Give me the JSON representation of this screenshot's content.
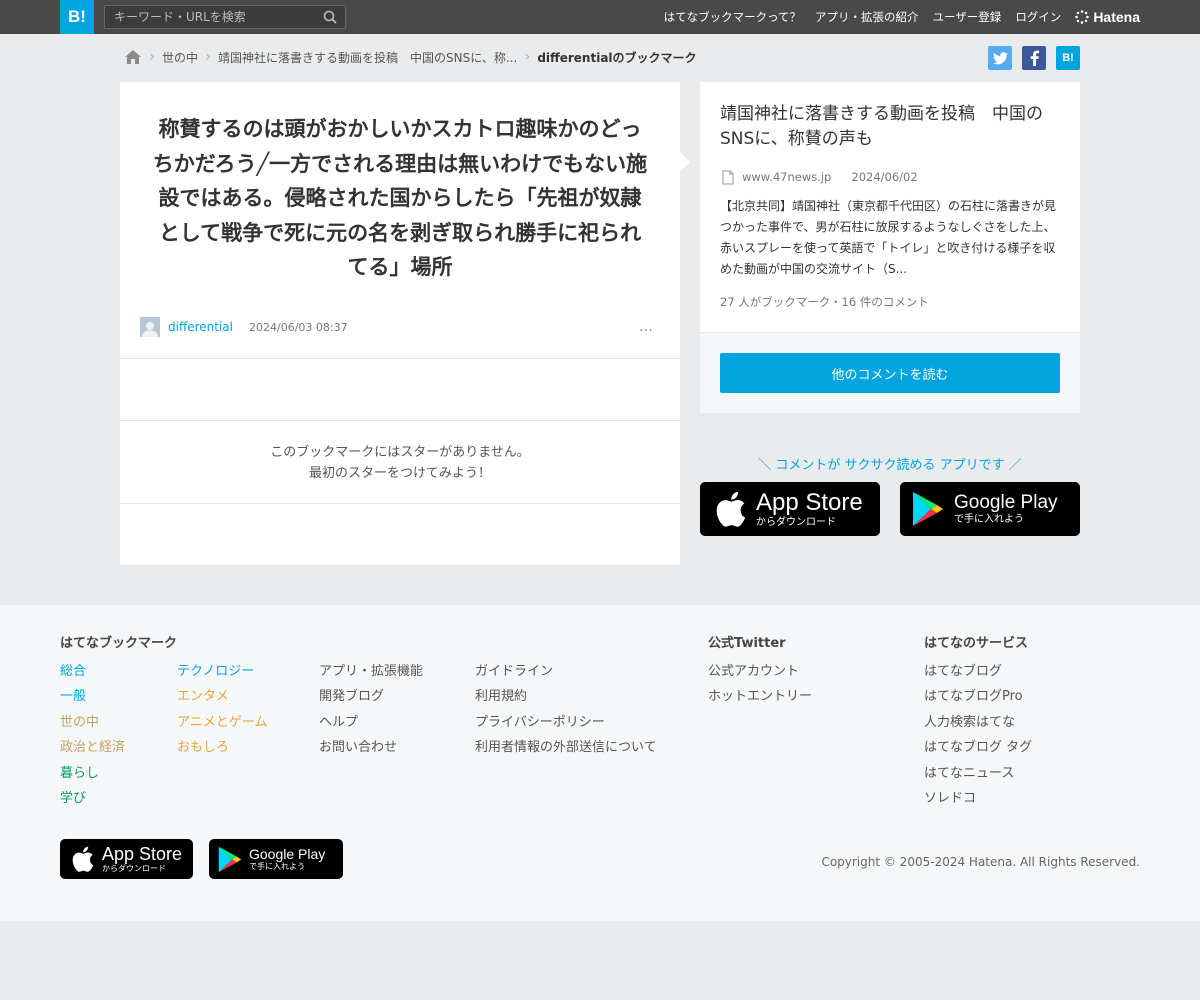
{
  "header": {
    "logo": "B!",
    "search_placeholder": "キーワード・URLを検索",
    "nav": [
      "はてなブックマークって？",
      "アプリ・拡張の紹介",
      "ユーザー登録",
      "ログイン"
    ],
    "brand": "Hatena"
  },
  "breadcrumb": {
    "items": [
      "世の中",
      "靖国神社に落書きする動画を投稿　中国のSNSに、称..."
    ],
    "current": "differentialのブックマーク"
  },
  "share": {
    "hatena": "B!"
  },
  "comment": {
    "text": "称賛するのは頭がおかしいかスカトロ趣味かのどっちかだろう╱一方でされる理由は無いわけでもない施設ではある。侵略された国からしたら「先祖が奴隷として戦争で死に元の名を剥ぎ取られ勝手に祀られてる」場所",
    "user": "differential",
    "datetime": "2024/06/03 08:37",
    "more": "…",
    "stars_line1": "このブックマークにはスターがありません。",
    "stars_line2": "最初のスターをつけてみよう！"
  },
  "entry": {
    "title": "靖国神社に落書きする動画を投稿　中国のSNSに、称賛の声も",
    "domain": "www.47news.jp",
    "date": "2024/06/02",
    "summary": "【北京共同】靖国神社（東京都千代田区）の石柱に落書きが見つかった事件で、男が石柱に放尿するようなしぐさをした上、赤いスプレーを使って英語で「トイレ」と吹き付ける様子を収めた動画が中国の交流サイト（S...",
    "counts": "27 人がブックマーク・16 件のコメント",
    "read_button": "他のコメントを読む"
  },
  "promo": {
    "text": "＼ コメントが サクサク読める アプリです ／",
    "appstore_big": "App Store",
    "appstore_small": "からダウンロード",
    "googleplay_big": "Google Play",
    "googleplay_small": "で手に入れよう"
  },
  "footer": {
    "bookmark_title": "はてなブックマーク",
    "categories_col1": [
      "総合",
      "一般",
      "世の中",
      "政治と経済",
      "暮らし",
      "学び"
    ],
    "categories_col2": [
      "テクノロジー",
      "エンタメ",
      "アニメとゲーム",
      "おもしろ"
    ],
    "links_col3": [
      "アプリ・拡張機能",
      "開発ブログ",
      "ヘルプ",
      "お問い合わせ"
    ],
    "links_col4": [
      "ガイドライン",
      "利用規約",
      "プライバシーポリシー",
      "利用者情報の外部送信について"
    ],
    "twitter_title": "公式Twitter",
    "twitter_links": [
      "公式アカウント",
      "ホットエントリー"
    ],
    "services_title": "はてなのサービス",
    "services_links": [
      "はてなブログ",
      "はてなブログPro",
      "人力検索はてな",
      "はてなブログ タグ",
      "はてなニュース",
      "ソレドコ"
    ],
    "copyright": "Copyright © 2005-2024 Hatena. All Rights Reserved."
  },
  "colors": {
    "header_bg": "#494949",
    "accent": "#00a4de",
    "cat_general": "#00a4de",
    "cat_social": "#c9a063",
    "cat_life": "#00a060",
    "cat_tech": "#00a4de",
    "cat_fun": "#e8a33d"
  }
}
